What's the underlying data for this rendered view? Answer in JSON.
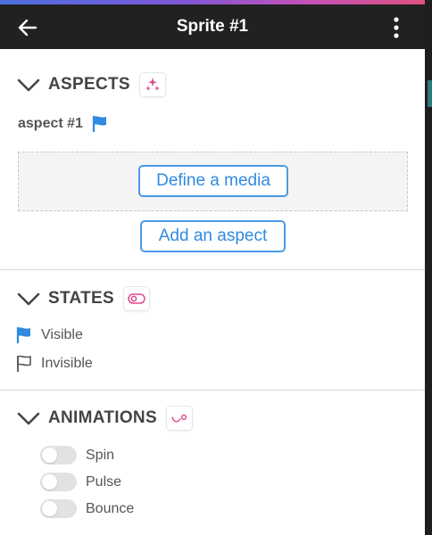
{
  "header": {
    "title": "Sprite #1",
    "back_icon": "arrow-left-icon",
    "menu_icon": "more-vertical-icon"
  },
  "colors": {
    "accent_blue": "#4a9ae6",
    "accent_pink": "#e0478f",
    "header_bg": "#212121"
  },
  "aspects": {
    "title": "ASPECTS",
    "badge_icon": "sparkle-icon",
    "aspect_name": "aspect #1",
    "aspect_icon": "flag-filled-icon",
    "define_media_label": "Define a media",
    "add_aspect_label": "Add an aspect"
  },
  "states": {
    "title": "STATES",
    "badge_icon": "toggle-icon",
    "items": [
      {
        "label": "Visible",
        "icon": "flag-filled-icon"
      },
      {
        "label": "Invisible",
        "icon": "flag-outline-icon"
      }
    ]
  },
  "animations": {
    "title": "ANIMATIONS",
    "badge_icon": "motion-path-icon",
    "items": [
      {
        "label": "Spin",
        "enabled": false
      },
      {
        "label": "Pulse",
        "enabled": false
      },
      {
        "label": "Bounce",
        "enabled": false
      }
    ]
  }
}
